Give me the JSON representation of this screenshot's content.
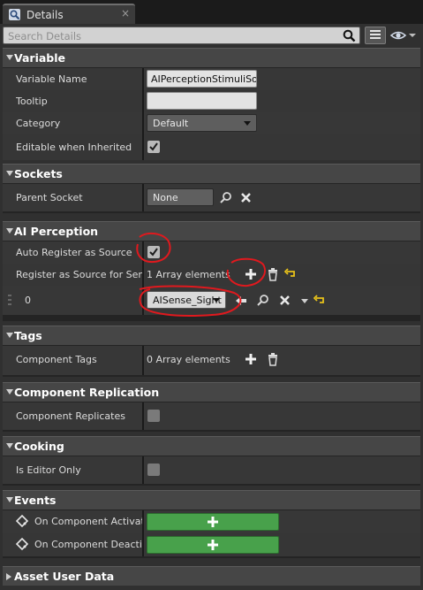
{
  "tab": {
    "label": "Details",
    "close": "×"
  },
  "search": {
    "placeholder": "Search Details"
  },
  "sections": {
    "variable": {
      "title": "Variable",
      "variable_name_label": "Variable Name",
      "variable_name_value": "AIPerceptionStimuliSou",
      "tooltip_label": "Tooltip",
      "tooltip_value": "",
      "category_label": "Category",
      "category_value": "Default",
      "editable_label": "Editable when Inherited",
      "editable_checked": true
    },
    "sockets": {
      "title": "Sockets",
      "parent_socket_label": "Parent Socket",
      "parent_socket_value": "None"
    },
    "ai_perception": {
      "title": "AI Perception",
      "auto_register_label": "Auto Register as Source",
      "auto_register_checked": true,
      "register_label": "Register as Source for Senses",
      "register_count": "1 Array elements",
      "element_index": "0",
      "element_value": "AISense_Sight"
    },
    "tags": {
      "title": "Tags",
      "component_tags_label": "Component Tags",
      "component_tags_count": "0 Array elements"
    },
    "replication": {
      "title": "Component Replication",
      "replicates_label": "Component Replicates",
      "replicates_checked": false
    },
    "cooking": {
      "title": "Cooking",
      "editor_only_label": "Is Editor Only",
      "editor_only_checked": false
    },
    "events": {
      "title": "Events",
      "activated_label": "On Component Activated",
      "deactivated_label": "On Component Deactivated"
    },
    "asset_user_data": {
      "title": "Asset User Data"
    }
  },
  "colors": {
    "panel_bg": "#303030",
    "header_bg": "#464646",
    "row_bg": "#373737",
    "event_button": "#48a14b",
    "annotation": "#e0191e"
  },
  "icons": [
    "details-tab-icon",
    "search-icon",
    "view-options-icon",
    "eye-icon",
    "browse-icon",
    "clear-icon",
    "add-icon",
    "delete-icon",
    "reset-arrow-icon",
    "use-selected-icon",
    "event-diamond-icon"
  ]
}
